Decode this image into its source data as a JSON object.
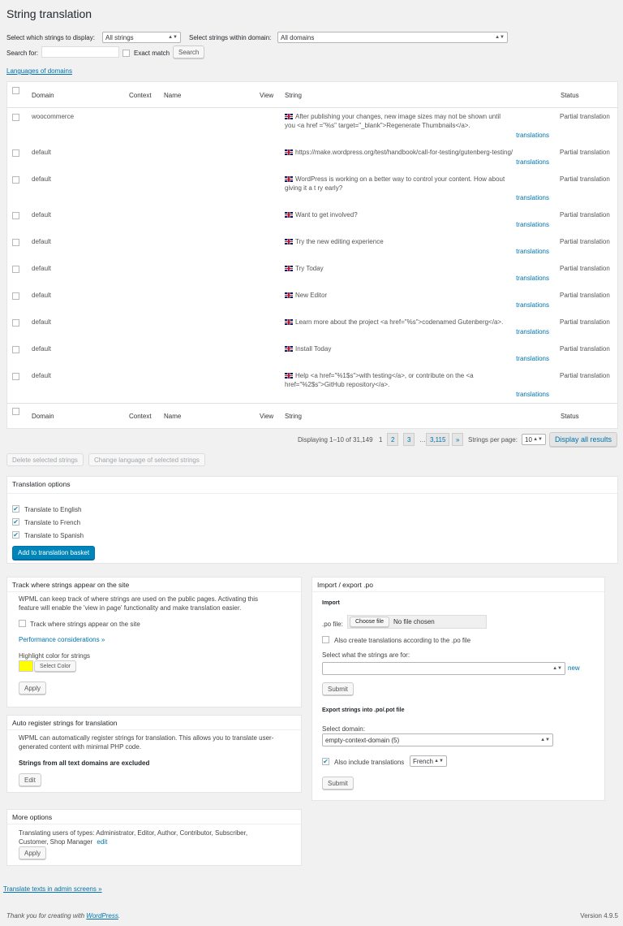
{
  "page": {
    "title": "String translation",
    "display_label": "Select which strings to display:",
    "display_value": "All strings",
    "domain_label": "Select strings within domain:",
    "domain_value": "All domains",
    "search_label": "Search for:",
    "search_value": "",
    "exact_match_label": "Exact match",
    "search_button": "Search",
    "languages_of_domains_link": "Languages of domains"
  },
  "table": {
    "headers": {
      "domain": "Domain",
      "context": "Context",
      "name": "Name",
      "view": "View",
      "string": "String",
      "status": "Status"
    },
    "translations_link": "translations",
    "rows": [
      {
        "domain": "woocommerce",
        "string": "After publishing your changes, new image sizes may not be shown until you <a href =\"%s\" target=\"_blank\">Regenerate Thumbnails</a>.",
        "status": "Partial translation"
      },
      {
        "domain": "default",
        "string": "https://make.wordpress.org/test/handbook/call-for-testing/gutenberg-testing/",
        "status": "Partial translation"
      },
      {
        "domain": "default",
        "string": "WordPress is working on a better way to control your content. How about giving it a t ry early?",
        "status": "Partial translation"
      },
      {
        "domain": "default",
        "string": "Want to get involved?",
        "status": "Partial translation"
      },
      {
        "domain": "default",
        "string": "Try the new editing experience",
        "status": "Partial translation"
      },
      {
        "domain": "default",
        "string": "Try Today",
        "status": "Partial translation"
      },
      {
        "domain": "default",
        "string": "New Editor",
        "status": "Partial translation"
      },
      {
        "domain": "default",
        "string": "Learn more about the project <a href=\"%s\">codenamed Gutenberg</a>.",
        "status": "Partial translation"
      },
      {
        "domain": "default",
        "string": "Install Today",
        "status": "Partial translation"
      },
      {
        "domain": "default",
        "string": "Help <a href=\"%1$s\">with testing</a>, or contribute on the <a href=\"%2$s\">GitHub repository</a>.",
        "status": "Partial translation"
      }
    ]
  },
  "pagination": {
    "displaying": "Displaying 1–10 of 31,149",
    "current": "1",
    "pages": [
      "2",
      "3"
    ],
    "ellipsis": "…",
    "last": "3,115",
    "next": "»",
    "per_page_label": "Strings per page:",
    "per_page_value": "10",
    "display_all": "Display all results"
  },
  "bulk": {
    "delete": "Delete selected strings",
    "change_language": "Change language of selected strings"
  },
  "translation_options": {
    "title": "Translation options",
    "languages": [
      {
        "label": "Translate to English",
        "checked": true
      },
      {
        "label": "Translate to French",
        "checked": true
      },
      {
        "label": "Translate to Spanish",
        "checked": true
      }
    ],
    "add_button": "Add to translation basket"
  },
  "track": {
    "title": "Track where strings appear on the site",
    "description": "WPML can keep track of where strings are used on the public pages. Activating this feature will enable the 'view in page' functionality and make translation easier.",
    "checkbox_label": "Track where strings appear on the site",
    "performance_link": "Performance considerations »",
    "highlight_label": "Highlight color for strings",
    "highlight_color": "#ffff00",
    "select_color": "Select Color",
    "apply": "Apply"
  },
  "auto_register": {
    "title": "Auto register strings for translation",
    "description": "WPML can automatically register strings for translation. This allows you to translate user-generated content with minimal PHP code.",
    "excluded": "Strings from all text domains are excluded",
    "edit": "Edit"
  },
  "more_options": {
    "title": "More options",
    "text": "Translating users of types: Administrator, Editor, Author, Contributor, Subscriber, Customer, Shop Manager",
    "edit_link": "edit",
    "apply": "Apply"
  },
  "import_export": {
    "title": "Import / export .po",
    "import_heading": "Import",
    "po_file_label": ".po file:",
    "choose_file": "Choose file",
    "no_file": "No file chosen",
    "also_create": "Also create translations according to the .po file",
    "select_for_label": "Select what the strings are for:",
    "select_for_value": "",
    "new_link": "new",
    "submit": "Submit",
    "export_heading": "Export strings into .po/.pot file",
    "select_domain_label": "Select domain:",
    "domain_value": "empty-context-domain (5)",
    "include_translations": "Also include translations",
    "language_value": "French",
    "submit2": "Submit"
  },
  "footer": {
    "translate_admin_link": "Translate texts in admin screens »",
    "thanks_prefix": "Thank you for creating with ",
    "wordpress_link": "WordPress",
    "thanks_suffix": ".",
    "version": "Version 4.9.5"
  }
}
